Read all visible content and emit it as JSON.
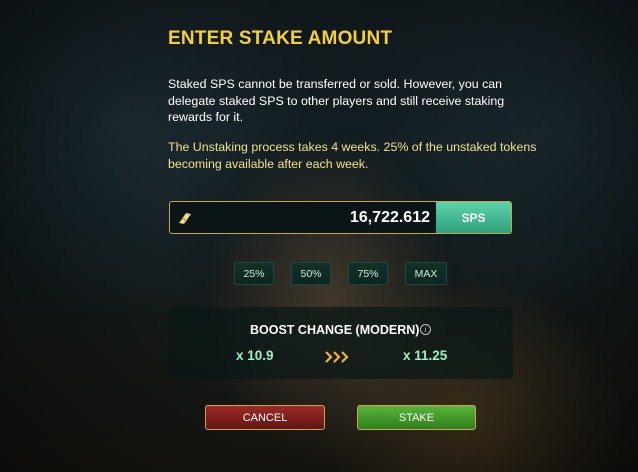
{
  "dialog": {
    "title": "ENTER STAKE AMOUNT",
    "description": "Staked SPS cannot be transferred or sold. However, you can delegate staked SPS to other players and still receive staking rewards for it.",
    "unstaking_note": "The Unstaking process takes 4 weeks. 25% of the unstaked tokens becoming available after each week."
  },
  "amount": {
    "value": "16,722.612",
    "currency": "SPS",
    "icon": "sps-token-icon"
  },
  "percent_buttons": [
    "25%",
    "50%",
    "75%",
    "MAX"
  ],
  "boost": {
    "title": "BOOST CHANGE (MODERN)",
    "info_icon": "i",
    "current": "x 10.9",
    "new": "x 11.25",
    "arrow_icon": "triple-chevron-right-icon"
  },
  "actions": {
    "cancel_label": "CANCEL",
    "stake_label": "STAKE"
  },
  "colors": {
    "title": "#f4cf3a",
    "note": "#f2e08a",
    "boost_value": "#9ef0c4",
    "sps_tag": "#3fb58f",
    "cancel": "#8a2420",
    "stake": "#4aa12f",
    "border_gold": "#c9a64a"
  }
}
